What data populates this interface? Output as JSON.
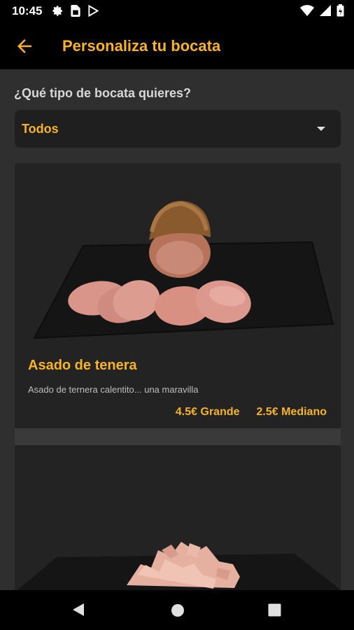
{
  "status_bar": {
    "time": "10:45",
    "left_icons": [
      "gear-icon",
      "sim-card-icon",
      "play-store-icon"
    ],
    "right_icons": [
      "wifi-icon",
      "signal-icon",
      "battery-icon"
    ]
  },
  "app_bar": {
    "back_icon": "arrow-left-icon",
    "title": "Personaliza tu bocata"
  },
  "filter": {
    "question": "¿Qué tipo de bocata quieres?",
    "selected": "Todos"
  },
  "cards": [
    {
      "title": "Asado de tenera",
      "description": "Asado de ternera calentito... una maravilla",
      "price_large": "4.5€ Grande",
      "price_medium": "2.5€ Mediano"
    },
    {
      "title": "",
      "description": ""
    }
  ],
  "colors": {
    "accent": "#f9b32a",
    "background": "#2f2f2f",
    "card": "#232323",
    "bar": "#000000"
  },
  "nav_bar": {
    "icons": [
      "nav-back-icon",
      "nav-home-icon",
      "nav-recent-icon"
    ]
  }
}
